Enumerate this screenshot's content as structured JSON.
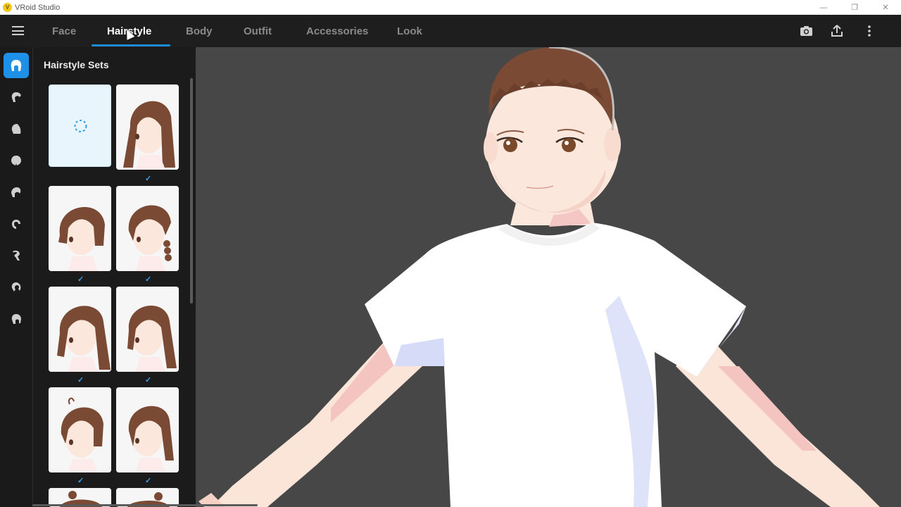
{
  "window": {
    "title": "VRoid Studio",
    "logo_glyph": "V",
    "controls": [
      "—",
      "❐",
      "✕"
    ]
  },
  "topbar": {
    "tabs": [
      {
        "label": "Face",
        "active": false
      },
      {
        "label": "Hairstyle",
        "active": true
      },
      {
        "label": "Body",
        "active": false
      },
      {
        "label": "Outfit",
        "active": false
      },
      {
        "label": "Accessories",
        "active": false
      },
      {
        "label": "Look",
        "active": false
      }
    ],
    "icons": [
      "camera-icon",
      "share-icon",
      "more-vertical-icon"
    ]
  },
  "sidebar": {
    "items": [
      {
        "icon": "hairstyle-sets-icon",
        "active": true
      },
      {
        "icon": "base-hair-icon",
        "active": false
      },
      {
        "icon": "front-hair-icon",
        "active": false
      },
      {
        "icon": "back-hair-icon",
        "active": false
      },
      {
        "icon": "side-hair-icon",
        "active": false
      },
      {
        "icon": "ahoge-icon",
        "active": false
      },
      {
        "icon": "braid-icon",
        "active": false
      },
      {
        "icon": "ponytail-icon",
        "active": false
      },
      {
        "icon": "extra-hair-icon",
        "active": false
      }
    ]
  },
  "panel": {
    "title": "Hairstyle Sets",
    "check_glyph": "✓",
    "presets": [
      {
        "style": "empty",
        "checked": false
      },
      {
        "style": "long",
        "checked": true
      },
      {
        "style": "bob",
        "checked": true
      },
      {
        "style": "braid",
        "checked": true
      },
      {
        "style": "ponytail-front",
        "checked": true
      },
      {
        "style": "ponytail-side",
        "checked": true
      },
      {
        "style": "short-ahoge",
        "checked": true
      },
      {
        "style": "side-tail",
        "checked": true
      },
      {
        "style": "bun",
        "checked": false
      },
      {
        "style": "bun2",
        "checked": false
      }
    ]
  },
  "colors": {
    "accent": "#1e90e8",
    "hair": "#7a4a34",
    "skin": "#fbe7dc",
    "shirt": "#ffffff",
    "background": "#474747"
  }
}
